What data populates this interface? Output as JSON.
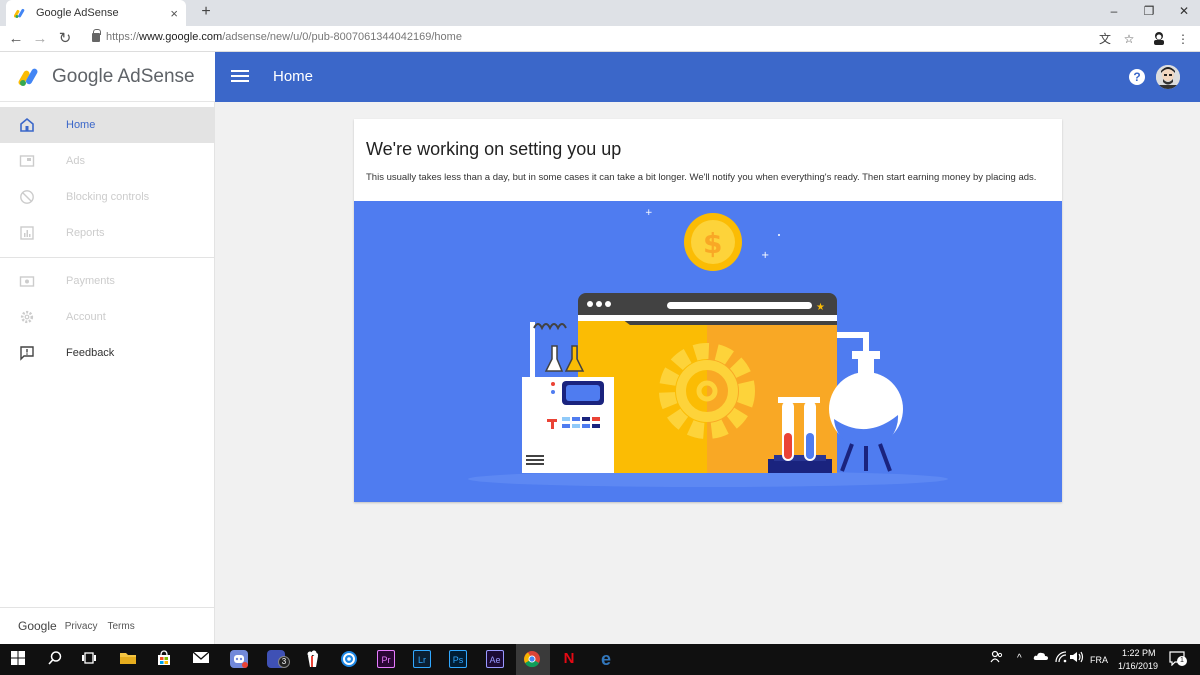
{
  "browser": {
    "tab_title": "Google AdSense",
    "tab_close": "×",
    "new_tab": "+",
    "url_prefix": "https://",
    "url_host": "www.google.com",
    "url_path": "/adsense/new/u/0/pub-8007061344042169/home",
    "back_icon": "←",
    "forward_icon": "→",
    "reload_icon": "↻",
    "minimize": "–",
    "maximize": "❐",
    "close": "✕",
    "translate_icon": "文",
    "star_icon": "☆",
    "menu_icon": "⋮"
  },
  "app": {
    "logo_text": "Google AdSense",
    "header_title": "Home",
    "help_label": "?"
  },
  "sidebar": {
    "items": [
      {
        "label": "Home",
        "icon": "home-icon",
        "state": "active"
      },
      {
        "label": "Ads",
        "icon": "ads-icon",
        "state": "disabled"
      },
      {
        "label": "Blocking controls",
        "icon": "block-icon",
        "state": "disabled"
      },
      {
        "label": "Reports",
        "icon": "reports-icon",
        "state": "disabled"
      },
      {
        "label": "Payments",
        "icon": "payments-icon",
        "state": "disabled"
      },
      {
        "label": "Account",
        "icon": "gear-icon",
        "state": "disabled"
      },
      {
        "label": "Feedback",
        "icon": "feedback-icon",
        "state": "enabled"
      }
    ],
    "footer": {
      "google": "Google",
      "privacy": "Privacy",
      "terms": "Terms"
    }
  },
  "main": {
    "title": "We're working on setting you up",
    "description": "This usually takes less than a day, but in some cases it can take a bit longer. We'll notify you when everything's ready. Then start earning money by placing ads."
  },
  "taskbar": {
    "apps": [
      {
        "name": "windows-start-icon",
        "label": ""
      },
      {
        "name": "search-icon",
        "label": ""
      },
      {
        "name": "task-view-icon",
        "label": ""
      },
      {
        "name": "file-explorer-icon",
        "label": ""
      },
      {
        "name": "store-icon",
        "label": ""
      },
      {
        "name": "mail-icon",
        "label": ""
      },
      {
        "name": "discord-icon",
        "label": ""
      },
      {
        "name": "instagram-icon",
        "label": "3"
      },
      {
        "name": "popcorn-icon",
        "label": ""
      },
      {
        "name": "uplay-icon",
        "label": ""
      },
      {
        "name": "premiere-icon",
        "label": "Pr"
      },
      {
        "name": "lightroom-icon",
        "label": "Lr"
      },
      {
        "name": "photoshop-icon",
        "label": "Ps"
      },
      {
        "name": "after-effects-icon",
        "label": "Ae"
      },
      {
        "name": "chrome-icon",
        "label": ""
      },
      {
        "name": "netflix-icon",
        "label": "N"
      },
      {
        "name": "edge-icon",
        "label": "e"
      }
    ],
    "language": "FRA",
    "time": "1:22 PM",
    "date": "1/16/2019",
    "notifications": "1"
  },
  "colors": {
    "brand_blue": "#3b67c9",
    "hero_blue": "#4f7cf0"
  }
}
